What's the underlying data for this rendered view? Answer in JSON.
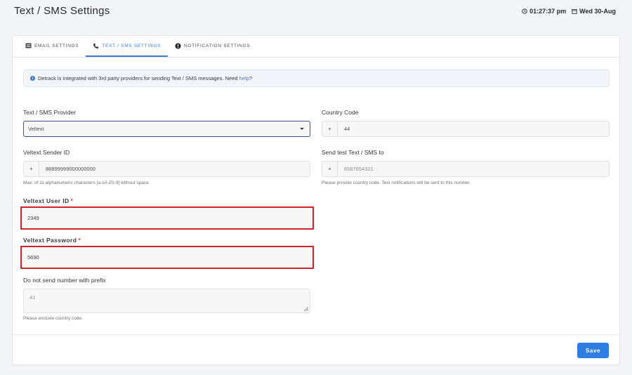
{
  "page": {
    "title": "Text / SMS Settings",
    "time": "01:27:37 pm",
    "date": "Wed 30-Aug"
  },
  "tabs": [
    {
      "label": "EMAIL SETTINGS",
      "icon": "list-icon",
      "active": false
    },
    {
      "label": "TEXT / SMS SETTINGS",
      "icon": "phone-icon",
      "active": true
    },
    {
      "label": "NOTIFICATION SETTINGS",
      "icon": "alert-icon",
      "active": false
    }
  ],
  "info": {
    "text_before": "Detrack is integrated with 3rd party providers for sending Text / SMS messages. Need ",
    "link": "help",
    "text_after": "?"
  },
  "form": {
    "provider_label": "Text / SMS Provider",
    "provider_value": "Veltext",
    "country_code_label": "Country Code",
    "country_code_prefix": "+",
    "country_code_value": "44",
    "sender_id_label": "Veltext Sender ID",
    "sender_id_prefix": "+",
    "sender_id_value": "88899999000000000",
    "sender_id_help": "Max. of 11 alphanumeric characters [a-zA-Z0-9] without space.",
    "test_label": "Send test Text / SMS to",
    "test_prefix": "+",
    "test_placeholder": "6587654321",
    "test_help": "Please provide country code. Test notifications will be sent to this number.",
    "user_id_label": "Veltext User ID",
    "user_id_value": "2349",
    "password_label": "Veltext Password",
    "password_value": "5690",
    "required_mark": "*",
    "prefix_label": "Do not send number with prefix",
    "prefix_placeholder": "41",
    "prefix_help": "Please exclude country code."
  },
  "actions": {
    "save_label": "Save"
  },
  "colors": {
    "accent": "#2f7de1",
    "highlight": "#d4202a",
    "select_border": "#3e4fa8"
  }
}
